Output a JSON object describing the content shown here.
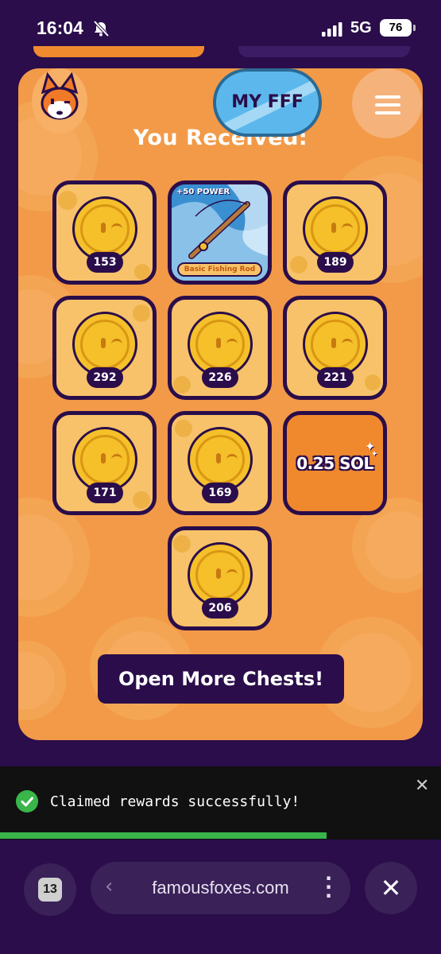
{
  "status_bar": {
    "time": "16:04",
    "network": "5G",
    "battery": "76",
    "icons": [
      "bell-off-icon",
      "signal-icon"
    ]
  },
  "header": {
    "my_fff_label": "MY FFF",
    "avatar_icon": "fox-avatar-icon",
    "menu_icon": "hamburger-menu-icon"
  },
  "rewards": {
    "title": "You Received:",
    "coin_amounts": [
      "153",
      "189",
      "292",
      "226",
      "221",
      "171",
      "169",
      "206"
    ],
    "item": {
      "power": "+50 POWER",
      "name": "Basic Fishing Rod"
    },
    "sol_reward": "0.25 SOL"
  },
  "actions": {
    "open_more_label": "Open More Chests!"
  },
  "toast": {
    "message": "Claimed rewards successfully!",
    "progress_fraction": 0.74,
    "icon": "check-circle-icon"
  },
  "browser": {
    "tab_count": "13",
    "url": "famousfoxes.com"
  },
  "colors": {
    "background": "#2a0d4a",
    "card": "#f29a48",
    "tile_border": "#2a0d4a",
    "toast_success": "#39b54a",
    "myfff_button": "#5cb8ec"
  }
}
